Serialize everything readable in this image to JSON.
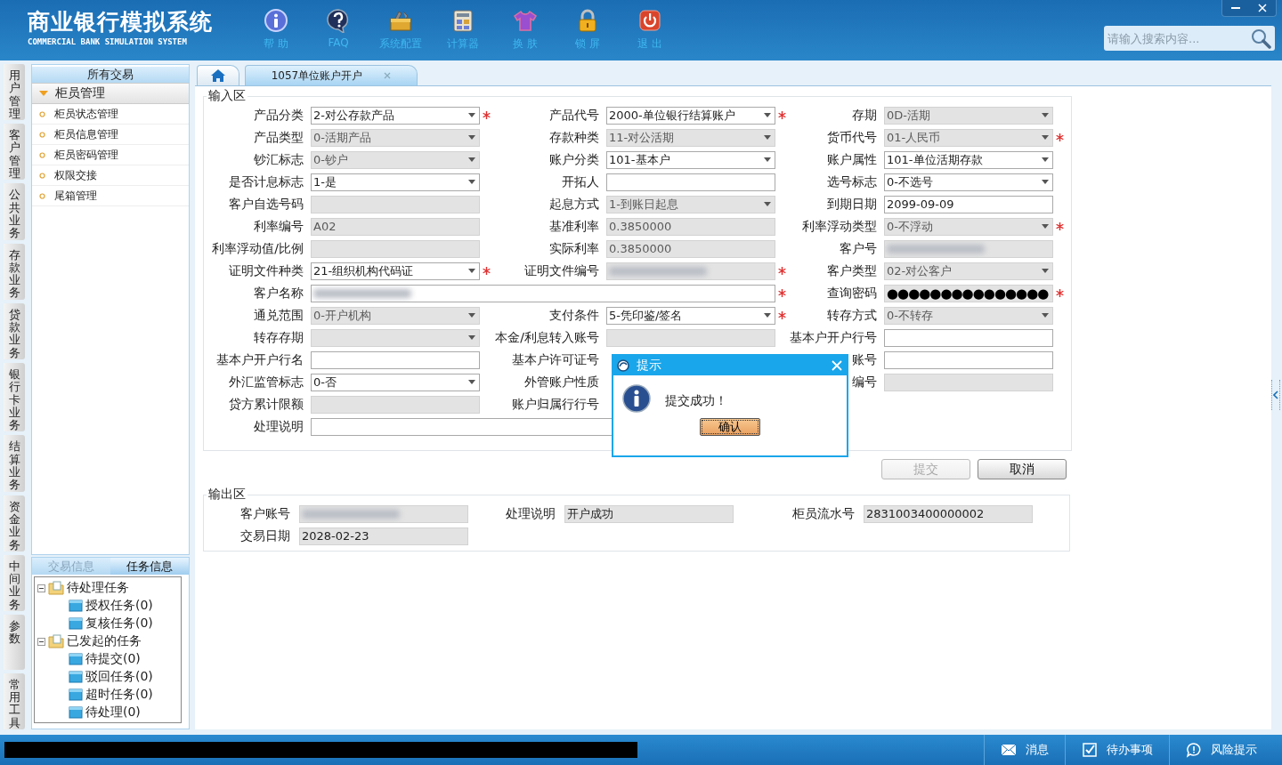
{
  "header": {
    "title": "商业银行模拟系统",
    "subtitle": "COMMERCIAL BANK SIMULATION SYSTEM",
    "tools": [
      {
        "kind": "help",
        "label": "帮 助"
      },
      {
        "kind": "faq",
        "label": "FAQ"
      },
      {
        "kind": "config",
        "label": "系统配置"
      },
      {
        "kind": "calculator",
        "label": "计算器"
      },
      {
        "kind": "skin",
        "label": "换 肤"
      },
      {
        "kind": "lock",
        "label": "锁 屏"
      },
      {
        "kind": "exit",
        "label": "退 出"
      }
    ],
    "search": {
      "placeholder": "请输入搜索内容..."
    }
  },
  "side_tabs": [
    "用户管理",
    "客户管理",
    "公共业务",
    "存款业务",
    "贷款业务",
    "银行卡业务",
    "结算业务",
    "资金业务",
    "中间业务",
    "参数",
    "常用工具"
  ],
  "sidebar": {
    "title": "所有交易",
    "groups": [
      {
        "label": "柜员管理",
        "expanded": true,
        "items": [
          "柜员状态管理",
          "柜员信息管理",
          "柜员密码管理",
          "权限交接",
          "尾箱管理"
        ]
      }
    ]
  },
  "task_panel": {
    "tabs": [
      {
        "label": "交易信息",
        "selected": false
      },
      {
        "label": "任务信息",
        "selected": true
      }
    ],
    "tree": [
      {
        "label": "待处理任务",
        "expanded": true,
        "children": [
          {
            "label": "授权任务(0)"
          },
          {
            "label": "复核任务(0)"
          }
        ]
      },
      {
        "label": "已发起的任务",
        "expanded": true,
        "children": [
          {
            "label": "待提交(0)"
          },
          {
            "label": "驳回任务(0)"
          },
          {
            "label": "超时任务(0)"
          },
          {
            "label": "待处理(0)"
          }
        ]
      }
    ]
  },
  "tabs": [
    {
      "kind": "home",
      "selected": false
    },
    {
      "kind": "page",
      "label": "1057单位账户开户",
      "selected": true
    }
  ],
  "input_area": {
    "title": "输入区",
    "rows": [
      [
        {
          "label": "产品分类",
          "input": {
            "kind": "select",
            "value": "2-对公存款产品",
            "disabled": false,
            "required": true
          }
        },
        {
          "label": "产品代号",
          "input": {
            "kind": "select",
            "value": "2000-单位银行结算账户",
            "disabled": false,
            "required": true
          }
        },
        {
          "label": "存期",
          "input": {
            "kind": "select",
            "value": "0D-活期",
            "disabled": true
          }
        }
      ],
      [
        {
          "label": "产品类型",
          "input": {
            "kind": "select",
            "value": "0-活期产品",
            "disabled": true
          }
        },
        {
          "label": "存款种类",
          "input": {
            "kind": "select",
            "value": "11-对公活期",
            "disabled": true
          }
        },
        {
          "label": "货币代号",
          "input": {
            "kind": "select",
            "value": "01-人民币",
            "disabled": true,
            "required": true
          }
        }
      ],
      [
        {
          "label": "钞汇标志",
          "input": {
            "kind": "select",
            "value": "0-钞户",
            "disabled": true
          }
        },
        {
          "label": "账户分类",
          "input": {
            "kind": "select",
            "value": "101-基本户",
            "disabled": false
          }
        },
        {
          "label": "账户属性",
          "input": {
            "kind": "select",
            "value": "101-单位活期存款",
            "disabled": false
          }
        }
      ],
      [
        {
          "label": "是否计息标志",
          "input": {
            "kind": "select",
            "value": "1-是",
            "disabled": false
          }
        },
        {
          "label": "开拓人",
          "input": {
            "kind": "text",
            "disabled": false
          }
        },
        {
          "label": "选号标志",
          "input": {
            "kind": "select",
            "value": "0-不选号",
            "disabled": false
          }
        }
      ],
      [
        {
          "label": "客户自选号码",
          "input": {
            "kind": "text",
            "disabled": true
          }
        },
        {
          "label": "起息方式",
          "input": {
            "kind": "select",
            "value": "1-到账日起息",
            "disabled": true
          }
        },
        {
          "label": "到期日期",
          "input": {
            "kind": "text",
            "value": "2099-09-09",
            "disabled": false
          }
        }
      ],
      [
        {
          "label": "利率编号",
          "input": {
            "kind": "text",
            "value": "A02",
            "disabled": true
          }
        },
        {
          "label": "基准利率",
          "input": {
            "kind": "text",
            "value": "0.3850000",
            "disabled": true
          }
        },
        {
          "label": "利率浮动类型",
          "input": {
            "kind": "select",
            "value": "0-不浮动",
            "disabled": true,
            "required": true
          }
        }
      ],
      [
        {
          "label": "利率浮动值/比例",
          "input": {
            "kind": "text",
            "disabled": true
          }
        },
        {
          "label": "实际利率",
          "input": {
            "kind": "text",
            "value": "0.3850000",
            "disabled": true
          }
        },
        {
          "label": "客户号",
          "input": {
            "kind": "text",
            "redacted": true,
            "disabled": true
          }
        }
      ],
      [
        {
          "label": "证明文件种类",
          "input": {
            "kind": "select",
            "value": "21-组织机构代码证",
            "disabled": false,
            "required": true
          }
        },
        {
          "label": "证明文件编号",
          "input": {
            "kind": "text",
            "redacted": true,
            "disabled": true,
            "required": true
          }
        },
        {
          "label": "客户类型",
          "input": {
            "kind": "select",
            "value": "02-对公客户",
            "disabled": true
          }
        }
      ],
      [
        {
          "label": "客户名称",
          "input": {
            "kind": "text",
            "wide": true,
            "redacted": true,
            "disabled": false,
            "required": true
          }
        },
        "",
        {
          "label": "查询密码",
          "input": {
            "kind": "password",
            "value": "●●●●●●●●●●●●●●●",
            "disabled": true,
            "required": true
          }
        }
      ],
      [
        {
          "label": "通兑范围",
          "input": {
            "kind": "select",
            "value": "0-开户机构",
            "disabled": true
          }
        },
        {
          "label": "支付条件",
          "input": {
            "kind": "select",
            "value": "5-凭印鉴/签名",
            "disabled": false,
            "required": true
          }
        },
        {
          "label": "转存方式",
          "input": {
            "kind": "select",
            "value": "0-不转存",
            "disabled": true
          }
        }
      ],
      [
        {
          "label": "转存存期",
          "input": {
            "kind": "select",
            "disabled": true
          }
        },
        {
          "label": "本金/利息转入账号",
          "input": {
            "kind": "text",
            "disabled": true
          }
        },
        {
          "label": "基本户开户行号",
          "input": {
            "kind": "text",
            "disabled": false
          }
        }
      ],
      [
        {
          "label": "基本户开户行名",
          "input": {
            "kind": "text",
            "disabled": false
          }
        },
        {
          "label": "基本户许可证号"
        },
        {
          "label": "账号",
          "input": {
            "kind": "text",
            "disabled": false
          }
        }
      ],
      [
        {
          "label": "外汇监管标志",
          "input": {
            "kind": "select",
            "value": "0-否",
            "disabled": false
          }
        },
        {
          "label": "外管账户性质"
        },
        {
          "label": "编号",
          "input": {
            "kind": "text",
            "disabled": true
          }
        }
      ],
      [
        {
          "label": "贷方累计限额",
          "input": {
            "kind": "text",
            "disabled": true
          }
        },
        {
          "label": "账户归属行行号"
        }
      ],
      [
        {
          "label": "处理说明",
          "input": {
            "kind": "text",
            "wide": true,
            "disabled": false
          }
        }
      ]
    ]
  },
  "buttons": [
    {
      "label": "提交",
      "disabled": true
    },
    {
      "label": "取消",
      "disabled": false
    }
  ],
  "output_area": {
    "title": "输出区",
    "rows": [
      [
        {
          "label": "客户账号",
          "redacted": true
        },
        {
          "label": "处理说明",
          "value": "开户成功"
        },
        {
          "label": "柜员流水号",
          "value": "2831003400000002"
        }
      ],
      [
        {
          "label": "交易日期",
          "value": "2028-02-23"
        }
      ]
    ]
  },
  "dialog": {
    "title": "提示",
    "message": "提交成功！",
    "button": "确认"
  },
  "status_bar": {
    "redacted": true,
    "items": [
      {
        "kind": "message",
        "label": "消息"
      },
      {
        "kind": "todo",
        "label": "待办事项"
      },
      {
        "kind": "risk",
        "label": "风险提示"
      }
    ]
  }
}
